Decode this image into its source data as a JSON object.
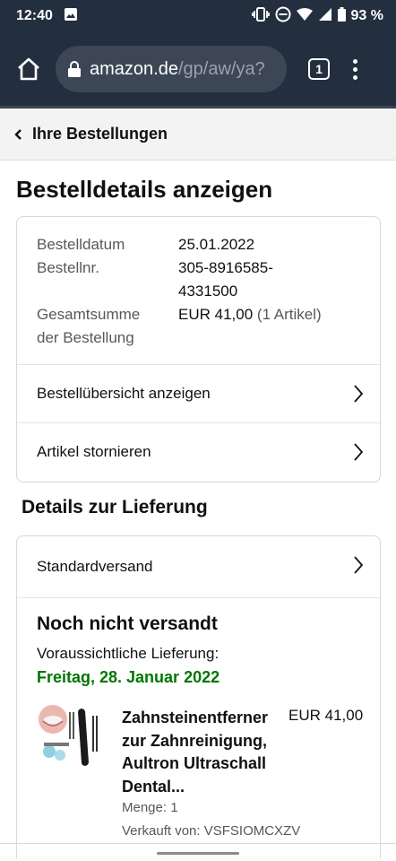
{
  "status_bar": {
    "time": "12:40",
    "battery": "93 %"
  },
  "browser": {
    "url_host": "amazon.de",
    "url_path": "/gp/aw/ya?",
    "tab_count": "1"
  },
  "breadcrumb": {
    "label": "Ihre Bestellungen"
  },
  "page": {
    "title": "Bestelldetails anzeigen"
  },
  "order": {
    "date_label": "Bestelldatum",
    "date_value": "25.01.2022",
    "number_label": "Bestellnr.",
    "number_value_line1": "305-8916585-",
    "number_value_line2": "4331500",
    "total_label_line1": "Gesamtsumme",
    "total_label_line2": "der Bestellung",
    "total_value": "EUR 41,00",
    "total_items": "(1 Artikel)",
    "summary_link": "Bestellübersicht anzeigen",
    "cancel_link": "Artikel stornieren"
  },
  "delivery": {
    "section_title": "Details zur Lieferung",
    "shipping_method": "Standardversand",
    "status": "Noch nicht versandt",
    "expected_label": "Voraussichtliche Lieferung:",
    "expected_date": "Freitag, 28. Januar 2022",
    "product": {
      "title_line1": "Zahnsteinentferner",
      "title_line2": "zur Zahnreinigung,",
      "title_line3": "Aultron Ultraschall",
      "title_line4": "Dental...",
      "price": "EUR 41,00",
      "quantity": "Menge: 1",
      "seller": "Verkauft von: VSFSIOMCXZV"
    }
  },
  "colors": {
    "header_bg": "#232f3e",
    "delivery_green": "#007600",
    "border": "#d5d9d9"
  }
}
